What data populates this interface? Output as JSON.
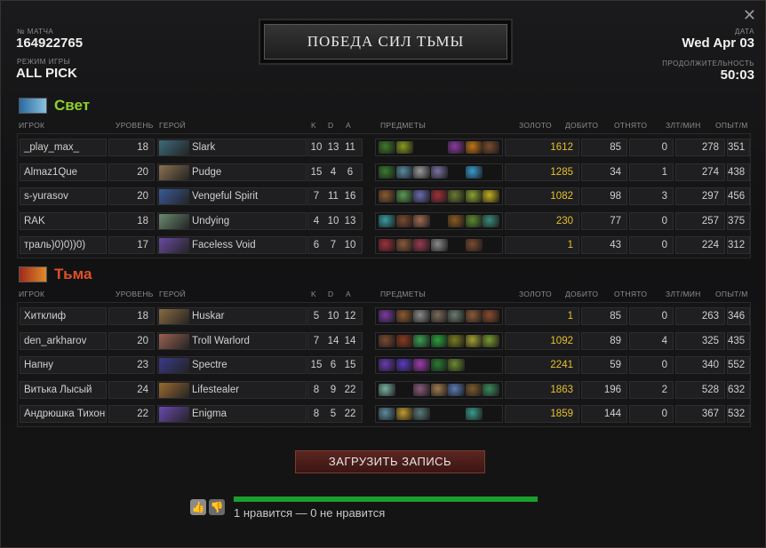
{
  "window": {
    "close_label": "✕"
  },
  "match": {
    "id_label": "№ МАТЧА",
    "id": "164922765",
    "mode_label": "РЕЖИМ ИГРЫ",
    "mode": "ALL PICK",
    "date_label": "ДАТА",
    "date": "Wed Apr 03",
    "duration_label": "ПРОДОЛЖИТЕЛЬНОСТЬ",
    "duration": "50:03",
    "result": "ПОБЕДА СИЛ ТЬМЫ"
  },
  "columns": {
    "player": "ИГРОК",
    "level": "УРОВЕНЬ",
    "hero": "ГЕРОЙ",
    "k": "K",
    "d": "D",
    "a": "A",
    "items": "ПРЕДМЕТЫ",
    "gold": "ЗОЛОТО",
    "lasthits": "ДОБИТО",
    "denies": "ОТНЯТО",
    "gpm": "ЗЛТ/МИН",
    "xpm": "ОПЫТ/М"
  },
  "teams": [
    {
      "name": "Свет",
      "color": "#8fd12b",
      "players": [
        {
          "name": "_play_max_",
          "level": "18",
          "hero": "Slark",
          "hero_color": "#3d6a7a",
          "k": "10",
          "d": "13",
          "a": "11",
          "items": [
            "#3d7a2a",
            "#8a9a20",
            "",
            "",
            "#8a3aa0",
            "#c0741a",
            "#7a4a30"
          ],
          "gold": "1612",
          "lh": "85",
          "dn": "0",
          "gpm": "278",
          "xpm": "351"
        },
        {
          "name": "Almaz1Que",
          "level": "20",
          "hero": "Pudge",
          "hero_color": "#8a7050",
          "k": "15",
          "d": "4",
          "a": "6",
          "items": [
            "#3a7a30",
            "#5a8aa0",
            "#9a9a9a",
            "#7a70a0",
            "",
            "#3a9ad0",
            ""
          ],
          "gold": "1285",
          "lh": "34",
          "dn": "1",
          "gpm": "274",
          "xpm": "438"
        },
        {
          "name": "s-yurasov",
          "level": "20",
          "hero": "Vengeful Spirit",
          "hero_color": "#3a5a9a",
          "k": "7",
          "d": "11",
          "a": "16",
          "items": [
            "#8a5a30",
            "#5a9a50",
            "#6a6ab0",
            "#a0303a",
            "#6a7a30",
            "#8aa030",
            "#c0b020"
          ],
          "gold": "1082",
          "lh": "98",
          "dn": "3",
          "gpm": "297",
          "xpm": "456"
        },
        {
          "name": "RAK",
          "level": "18",
          "hero": "Undying",
          "hero_color": "#6a8a70",
          "k": "4",
          "d": "10",
          "a": "13",
          "items": [
            "#3a9aa0",
            "#7a4a30",
            "#a06a50",
            "",
            "#8a5a20",
            "#5a8a30",
            "#3a8a7a"
          ],
          "gold": "230",
          "lh": "77",
          "dn": "0",
          "gpm": "257",
          "xpm": "375"
        },
        {
          "name": "траль)0)0))0)",
          "level": "17",
          "hero": "Faceless Void",
          "hero_color": "#6a4aa0",
          "k": "6",
          "d": "7",
          "a": "10",
          "items": [
            "#a0303a",
            "#8a5a3a",
            "#9a3a50",
            "#8a8a8a",
            "",
            "#7a4a30",
            ""
          ],
          "gold": "1",
          "lh": "43",
          "dn": "0",
          "gpm": "224",
          "xpm": "312"
        }
      ]
    },
    {
      "name": "Тьма",
      "color": "#e0502a",
      "players": [
        {
          "name": "Хитклиф",
          "level": "18",
          "hero": "Huskar",
          "hero_color": "#8a6a40",
          "k": "5",
          "d": "10",
          "a": "12",
          "items": [
            "#7a3aa0",
            "#8a5a30",
            "#8a8a8a",
            "#7a6a5a",
            "#6a7a70",
            "#8a5a3a",
            "#8a4a30"
          ],
          "gold": "1",
          "lh": "85",
          "dn": "0",
          "gpm": "263",
          "xpm": "346"
        },
        {
          "name": "den_arkharov",
          "level": "20",
          "hero": "Troll Warlord",
          "hero_color": "#9a6050",
          "k": "7",
          "d": "14",
          "a": "14",
          "items": [
            "#7a4a30",
            "#8a3a20",
            "#3aa050",
            "#2aa03a",
            "#7a7a20",
            "#a0a030",
            "#7a9a30"
          ],
          "gold": "1092",
          "lh": "89",
          "dn": "4",
          "gpm": "325",
          "xpm": "435"
        },
        {
          "name": "Напну",
          "level": "23",
          "hero": "Spectre",
          "hero_color": "#3a3a8a",
          "k": "15",
          "d": "6",
          "a": "15",
          "items": [
            "#6a3ab0",
            "#5a3ac0",
            "#a03ab0",
            "#2a7a30",
            "#6a8a30",
            "",
            ""
          ],
          "gold": "2241",
          "lh": "59",
          "dn": "0",
          "gpm": "340",
          "xpm": "552"
        },
        {
          "name": "Витька Лысый",
          "level": "24",
          "hero": "Lifestealer",
          "hero_color": "#9a6a30",
          "k": "8",
          "d": "9",
          "a": "22",
          "items": [
            "#7ab0a0",
            "",
            "#8a5a7a",
            "#a07a50",
            "#5a7ab0",
            "#7a5a30",
            "#3a8a5a"
          ],
          "gold": "1863",
          "lh": "196",
          "dn": "2",
          "gpm": "528",
          "xpm": "632"
        },
        {
          "name": "Андрюшка Тихон",
          "level": "22",
          "hero": "Enigma",
          "hero_color": "#6a4ab0",
          "k": "8",
          "d": "5",
          "a": "22",
          "items": [
            "#5a8a9a",
            "#c09a30",
            "#5a7a7a",
            "",
            "",
            "#3a9a8a",
            ""
          ],
          "gold": "1859",
          "lh": "144",
          "dn": "0",
          "gpm": "367",
          "xpm": "532"
        }
      ]
    }
  ],
  "footer": {
    "download_label": "ЗАГРУЗИТЬ ЗАПИСЬ",
    "likes": 1,
    "dislikes": 0,
    "likes_text": "1 нравится — 0 не нравится",
    "like_icon": "thumbs-up-icon",
    "dislike_icon": "thumbs-down-icon"
  }
}
